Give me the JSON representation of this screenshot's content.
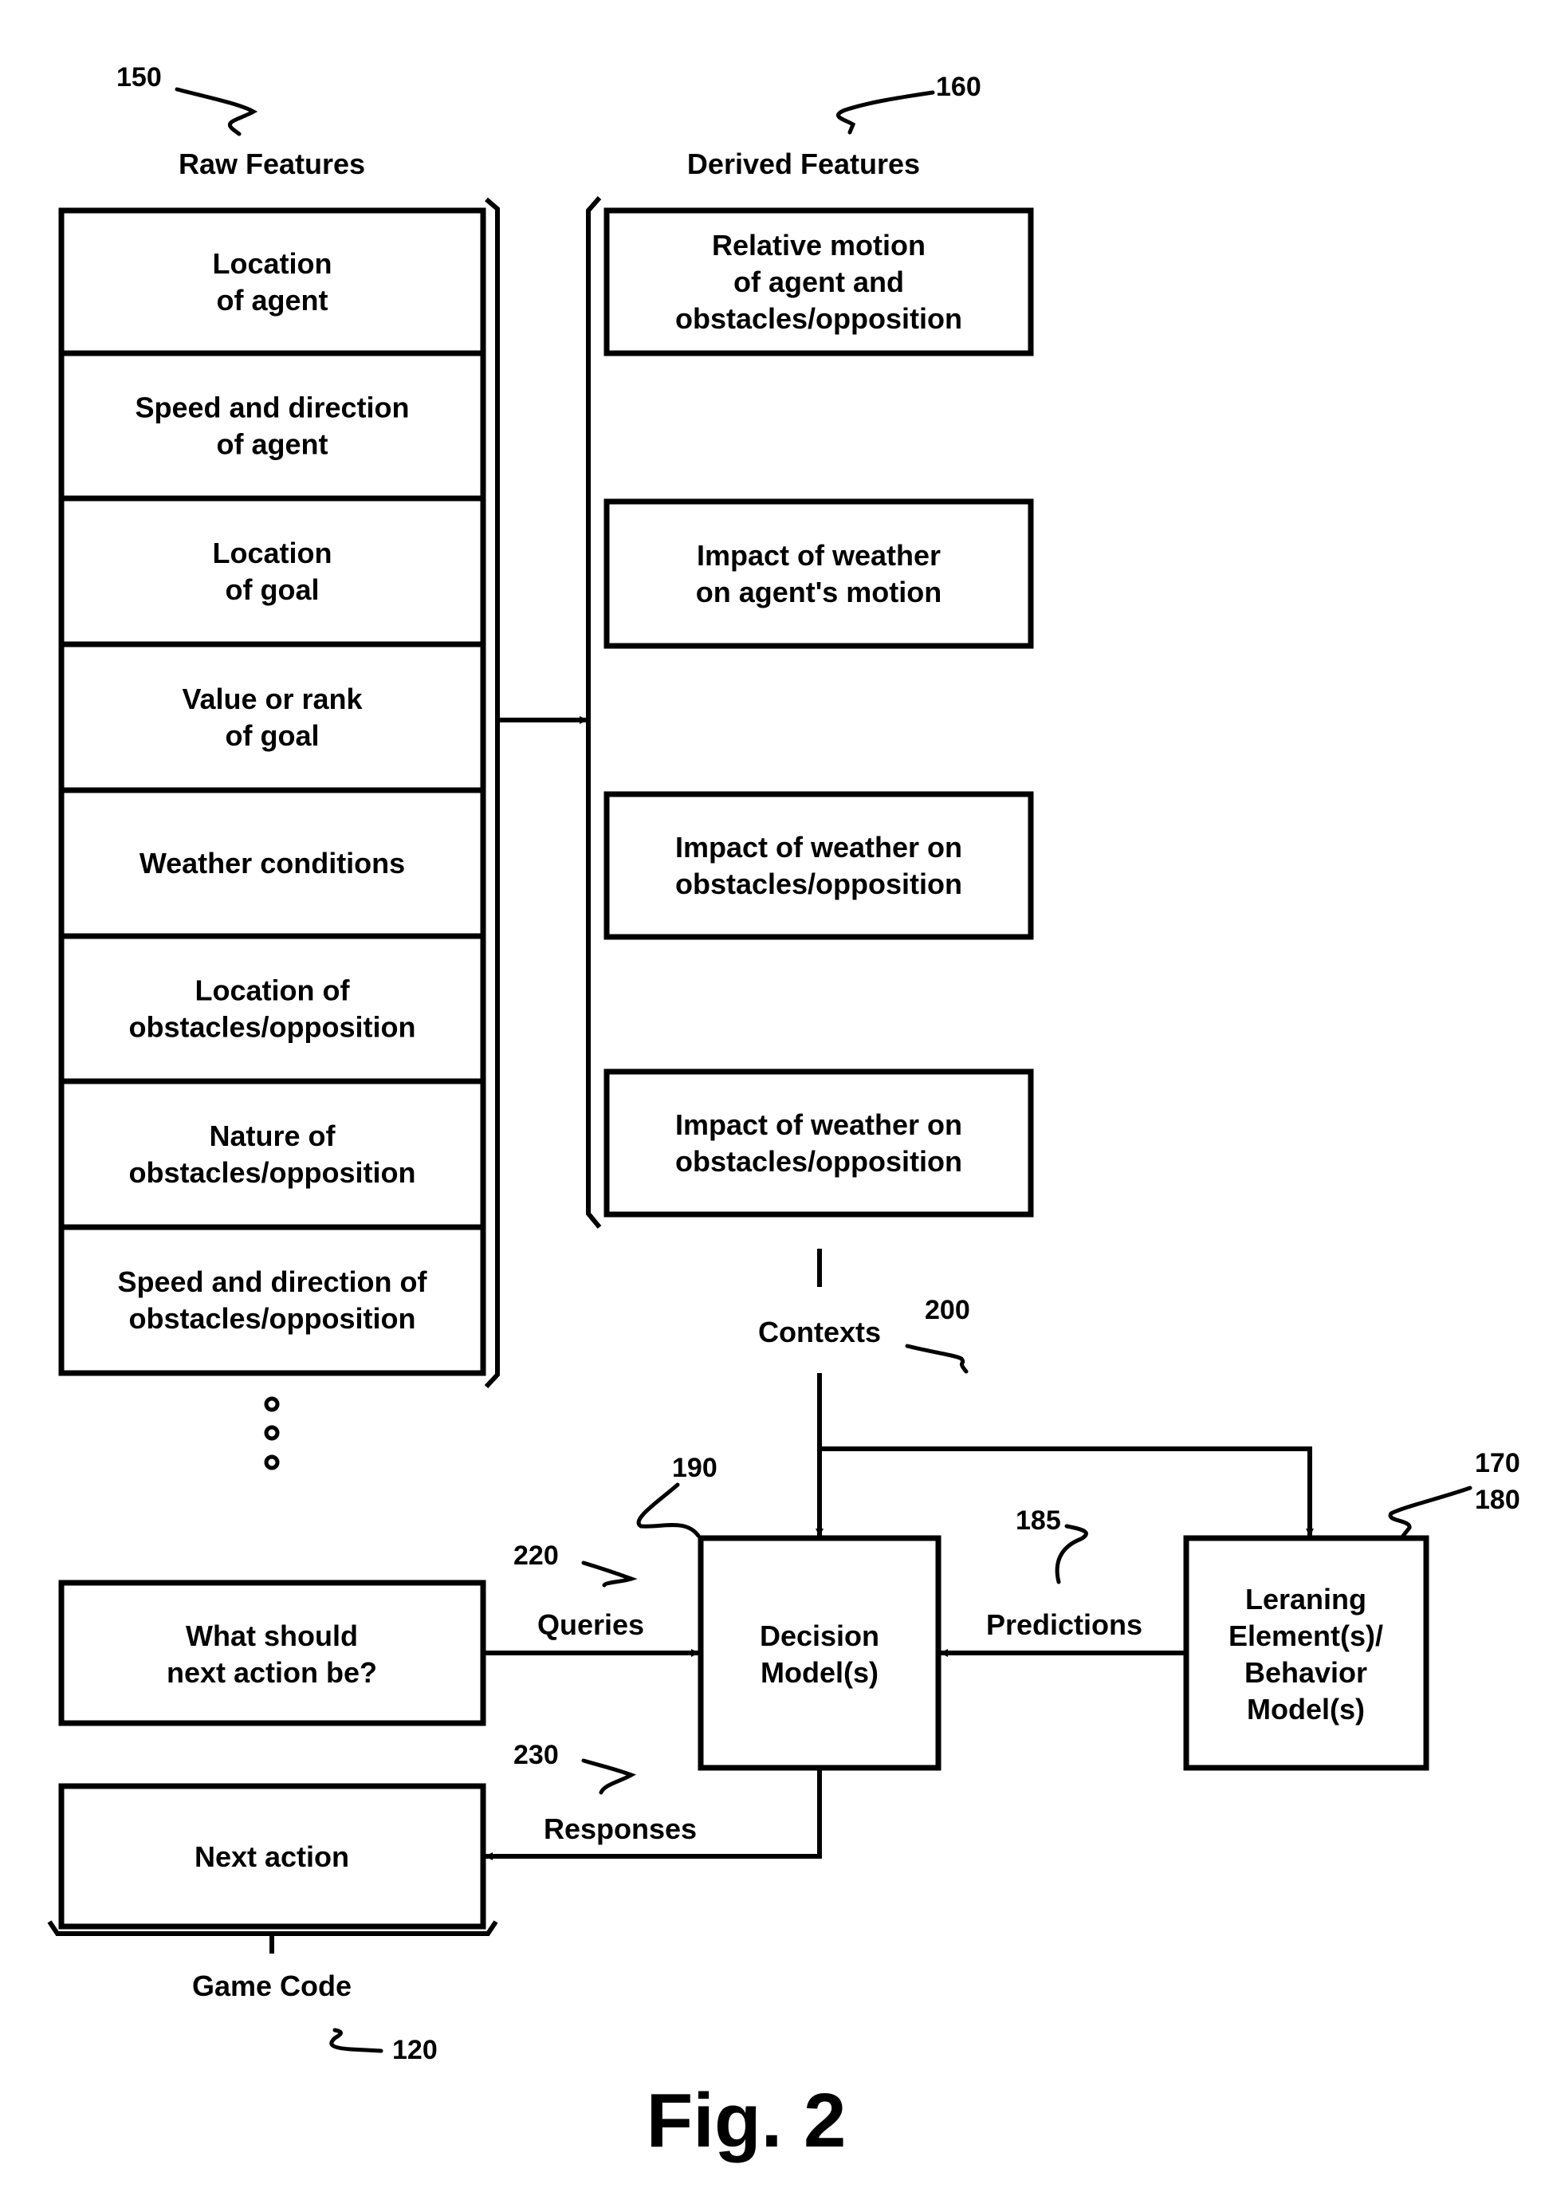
{
  "figure": {
    "caption": "Fig. 2",
    "raw_features": {
      "ref": "150",
      "title": "Raw Features",
      "items": [
        [
          "Location",
          "of agent"
        ],
        [
          "Speed and direction",
          "of agent"
        ],
        [
          "Location",
          "of goal"
        ],
        [
          "Value or rank",
          "of goal"
        ],
        [
          "Weather conditions"
        ],
        [
          "Location of",
          "obstacles/opposition"
        ],
        [
          "Nature of",
          "obstacles/opposition"
        ],
        [
          "Speed and direction of",
          "obstacles/opposition"
        ]
      ]
    },
    "derived_features": {
      "ref": "160",
      "title": "Derived Features",
      "items": [
        [
          "Relative motion",
          "of agent and",
          "obstacles/opposition"
        ],
        [
          "Impact of weather",
          "on agent's motion"
        ],
        [
          "Impact of weather on",
          "obstacles/opposition"
        ],
        [
          "Impact of weather on",
          "obstacles/opposition"
        ]
      ]
    },
    "contexts": {
      "label": "Contexts",
      "ref": "200"
    },
    "decision_model": {
      "lines": [
        "Decision",
        "Model(s)"
      ],
      "ref": "190"
    },
    "learning_element": {
      "lines": [
        "Leraning",
        "Element(s)/",
        "Behavior",
        "Model(s)"
      ],
      "ref_a": "170",
      "ref_b": "180"
    },
    "predictions": {
      "label": "Predictions",
      "ref": "185"
    },
    "queries": {
      "label": "Queries",
      "ref": "220"
    },
    "responses": {
      "label": "Responses",
      "ref": "230"
    },
    "game_code": {
      "label": "Game Code",
      "ref": "120",
      "query_box": [
        "What should",
        "next action be?"
      ],
      "action_box": [
        "Next action"
      ]
    }
  }
}
